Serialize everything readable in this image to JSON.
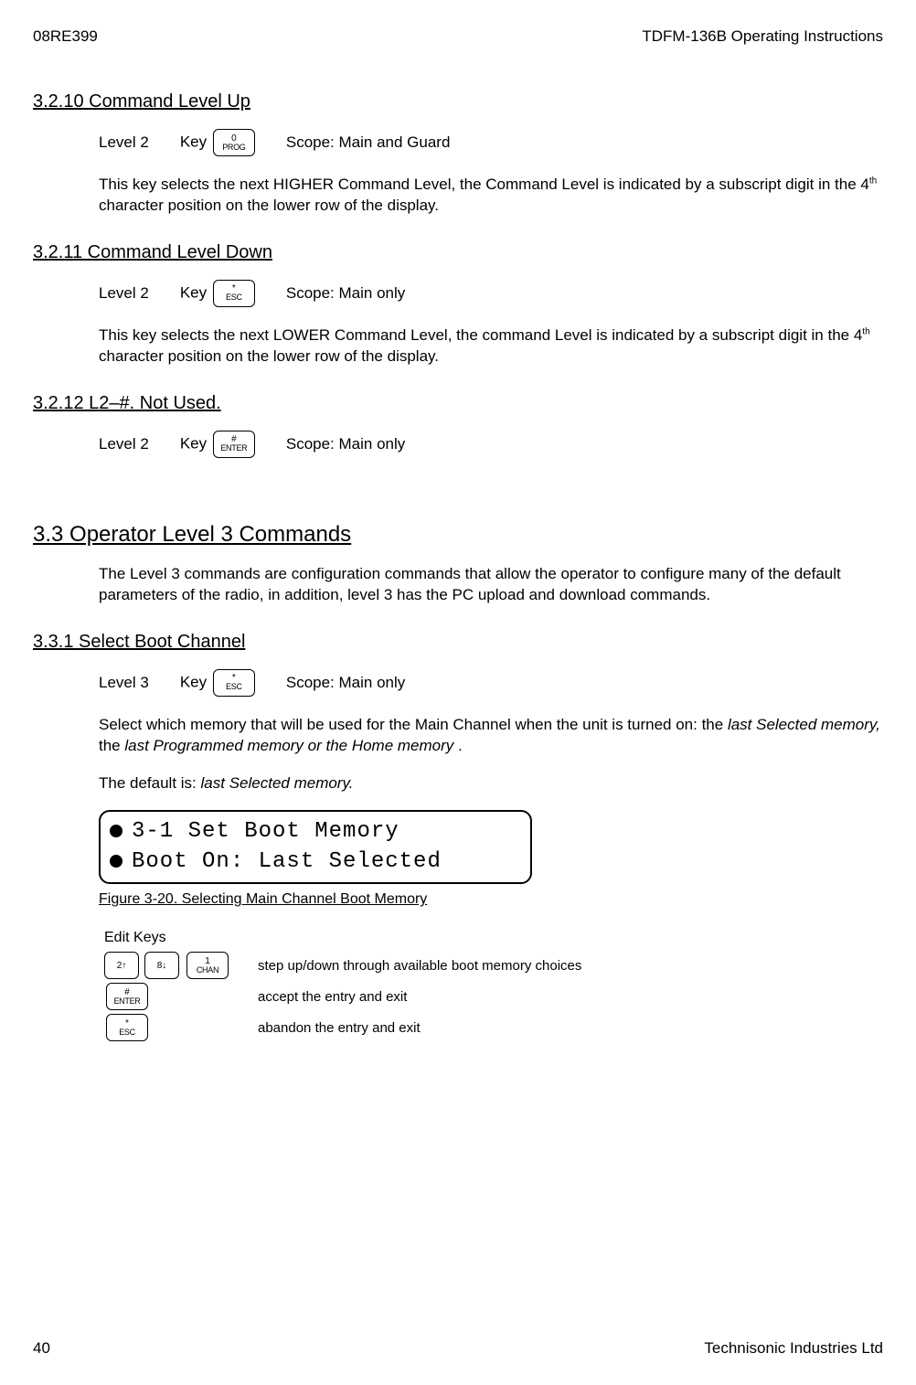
{
  "header": {
    "left": "08RE399",
    "right": "TDFM-136B Operating Instructions"
  },
  "footer": {
    "left": "40",
    "right": "Technisonic Industries Ltd"
  },
  "s3210": {
    "title": "3.2.10   Command Level Up",
    "level": "Level 2",
    "keylabel": "Key",
    "keycap": {
      "top": "0",
      "bot": "PROG"
    },
    "scope": "Scope: Main and Guard",
    "para_a": "This key selects the next HIGHER Command Level, the Command Level is indicated by a subscript digit in the 4",
    "para_sup": "th",
    "para_b": " character position on the lower row of the display."
  },
  "s3211": {
    "title": "3.2.11   Command Level Down",
    "level": "Level 2",
    "keylabel": "Key",
    "keycap": {
      "top": "*",
      "bot": "ESC"
    },
    "scope": "Scope: Main only",
    "para_a": "This key selects the next LOWER Command Level, the command Level is indicated by a subscript digit in the 4",
    "para_sup": "th",
    "para_b": " character position on the lower row of the display."
  },
  "s3212": {
    "title": "3.2.12   L2–#.  Not Used.",
    "level": "Level 2",
    "keylabel": "Key",
    "keycap": {
      "top": "#",
      "bot": "ENTER"
    },
    "scope": "Scope: Main only"
  },
  "s33": {
    "title": "3.3   Operator Level 3 Commands",
    "para": "The Level 3 commands are configuration commands that allow the operator to configure many of the default parameters of the radio, in addition, level 3 has the PC upload and download commands."
  },
  "s331": {
    "title": "3.3.1   Select Boot Channel",
    "level": "Level 3",
    "keylabel": "Key",
    "keycap": {
      "top": "*",
      "bot": "ESC"
    },
    "scope": "Scope: Main only",
    "para1_a": "Select which memory that will be used for the Main Channel when the unit is turned on: the ",
    "para1_i1": "last Selected memory,",
    "para1_b": " the ",
    "para1_i2": "last Programmed memory or the Home memory",
    "para1_c": " .",
    "para2_a": "The default is: ",
    "para2_i": "last Selected memory.",
    "lcd_line1": "3-1 Set Boot Memory",
    "lcd_line2": "Boot On: Last Selected",
    "fig": "Figure 3-20. Selecting Main Channel Boot Memory",
    "edit_title": "Edit Keys",
    "edit_rows": [
      {
        "keycaps": [
          {
            "type": "arrow",
            "label": "2↑"
          },
          {
            "type": "arrow",
            "label": "8↓"
          },
          {
            "type": "key",
            "top": "1",
            "bot": "CHAN"
          }
        ],
        "desc": "step up/down through available boot memory choices"
      },
      {
        "keycaps": [
          {
            "type": "key",
            "top": "#",
            "bot": "ENTER"
          }
        ],
        "desc": "accept the entry and exit"
      },
      {
        "keycaps": [
          {
            "type": "key",
            "top": "*",
            "bot": "ESC"
          }
        ],
        "desc": "abandon the entry and exit"
      }
    ]
  }
}
